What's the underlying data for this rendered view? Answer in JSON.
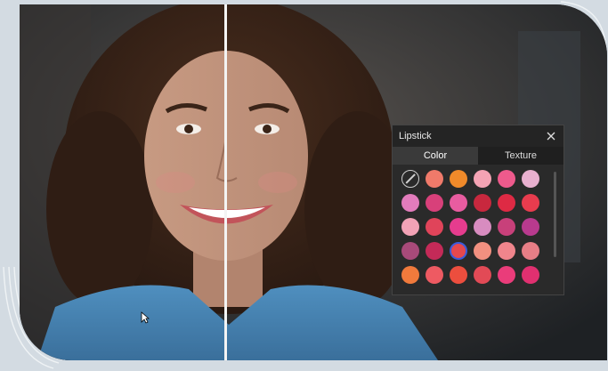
{
  "panel": {
    "title": "Lipstick",
    "tabs": [
      {
        "label": "Color",
        "active": true
      },
      {
        "label": "Texture",
        "active": false
      }
    ],
    "selected_index": 20,
    "swatches": [
      "none",
      "#f07a6a",
      "#f08a2a",
      "#f4a3b4",
      "#ee5a8c",
      "#e8b0cf",
      "#e27cbc",
      "#d8407a",
      "#e85ca0",
      "#c8283e",
      "#de2a44",
      "#e83c4e",
      "#f2a2b6",
      "#e0445a",
      "#e63c8e",
      "#d88cc0",
      "#c8407a",
      "#b83a8e",
      "#a84a7a",
      "#c42a58",
      "#e6484e",
      "#f29080",
      "#f0858c",
      "#e77e86",
      "#f07a3c",
      "#ee5a62",
      "#ec4e3e",
      "#e24a56",
      "#ea3c7a",
      "#e03070"
    ]
  },
  "icons": {
    "close": "close-icon",
    "cursor": "mouse-pointer-icon"
  }
}
